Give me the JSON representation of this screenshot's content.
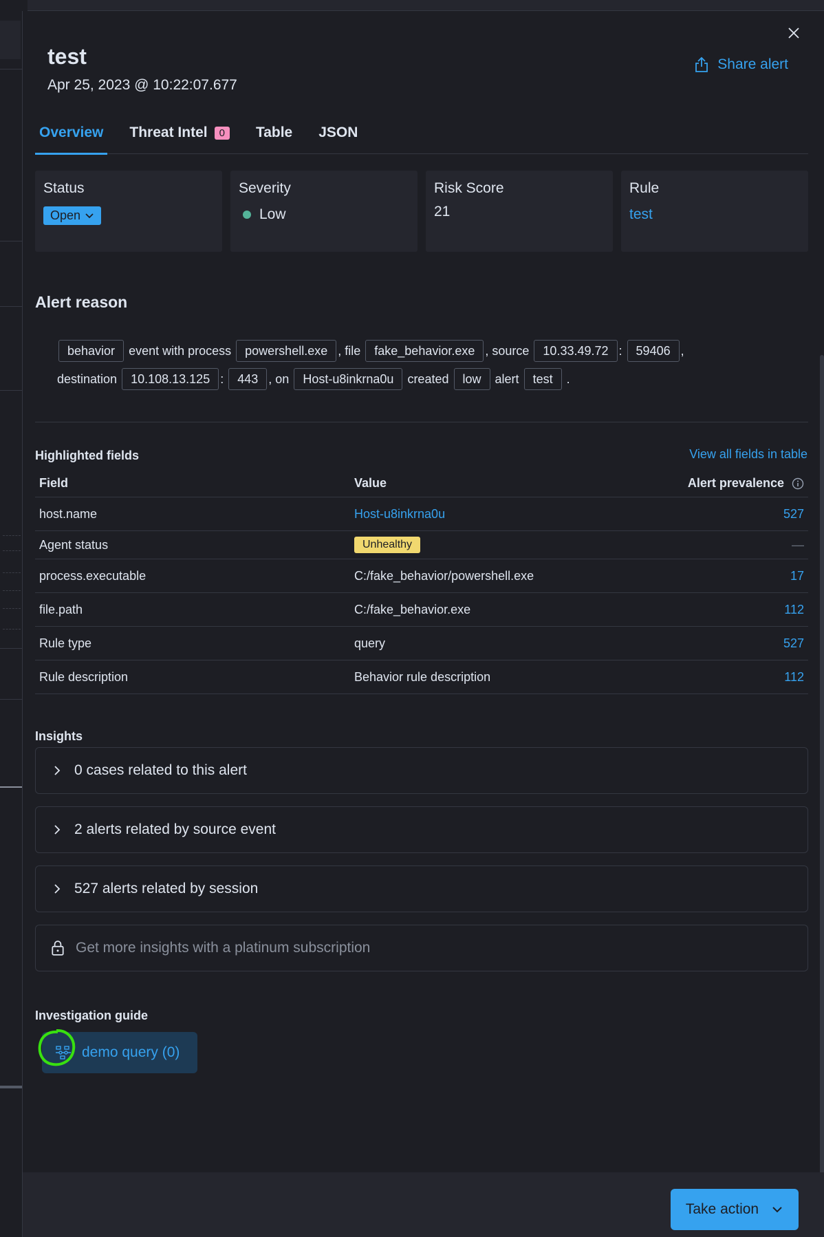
{
  "flyout": {
    "title": "test",
    "timestamp": "Apr 25, 2023 @ 10:22:07.677",
    "share_label": "Share alert",
    "tabs": [
      {
        "label": "Overview",
        "active": true
      },
      {
        "label": "Threat Intel",
        "badge": "0"
      },
      {
        "label": "Table"
      },
      {
        "label": "JSON"
      }
    ]
  },
  "summary": {
    "status": {
      "label": "Status",
      "value": "Open"
    },
    "severity": {
      "label": "Severity",
      "value": "Low",
      "color": "#54b399"
    },
    "risk": {
      "label": "Risk Score",
      "value": "21"
    },
    "rule": {
      "label": "Rule",
      "value": "test"
    }
  },
  "reason": {
    "heading": "Alert reason",
    "parts": {
      "t1": "behavior",
      "s1": "event with process",
      "t2": "powershell.exe",
      "s2": ", file",
      "t3": "fake_behavior.exe",
      "s3": ", source",
      "t4": "10.33.49.72",
      "s4": ":",
      "t5": "59406",
      "s5": ",",
      "s6": "destination",
      "t6": "10.108.13.125",
      "s7": ":",
      "t7": "443",
      "s8": ", on",
      "t8": "Host-u8inkrna0u",
      "s9": "created",
      "t9": "low",
      "s10": "alert",
      "t10": "test",
      "s11": "."
    }
  },
  "highlighted": {
    "heading": "Highlighted fields",
    "view_all": "View all fields in table",
    "columns": {
      "field": "Field",
      "value": "Value",
      "prevalence": "Alert prevalence"
    },
    "rows": [
      {
        "field": "host.name",
        "value": "Host-u8inkrna0u",
        "prevalence": "527"
      },
      {
        "field": "Agent status",
        "value": "Unhealthy",
        "prevalence": "—"
      },
      {
        "field": "process.executable",
        "value": "C:/fake_behavior/powershell.exe",
        "prevalence": "17"
      },
      {
        "field": "file.path",
        "value": "C:/fake_behavior.exe",
        "prevalence": "112"
      },
      {
        "field": "Rule type",
        "value": "query",
        "prevalence": "527"
      },
      {
        "field": "Rule description",
        "value": "Behavior rule description",
        "prevalence": "112"
      }
    ]
  },
  "insights": {
    "heading": "Insights",
    "items": [
      "0 cases related to this alert",
      "2 alerts related by source event",
      "527 alerts related by session"
    ],
    "upsell": "Get more insights with a platinum subscription"
  },
  "guide": {
    "heading": "Investigation guide",
    "button": "demo query (0)"
  },
  "footer": {
    "take_action": "Take action"
  },
  "colors": {
    "accent": "#36a2ef",
    "warning": "#f1d86f",
    "badge": "#f68fbe",
    "annotation": "#39e010"
  }
}
